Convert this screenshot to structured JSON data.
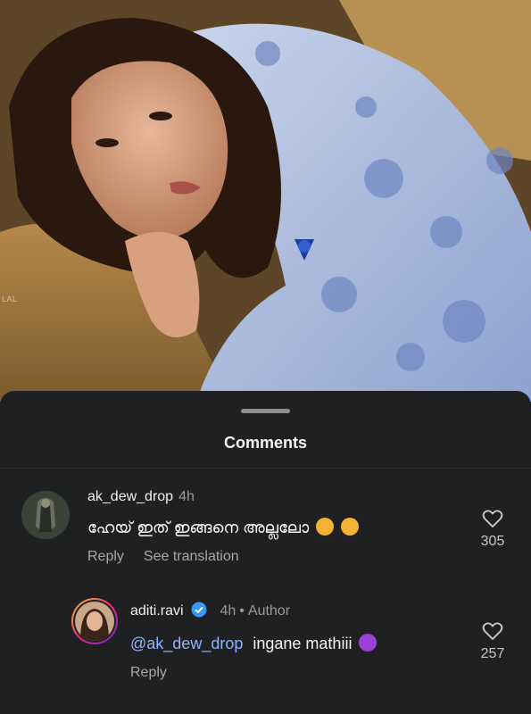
{
  "photo": {
    "watermark": "LAL"
  },
  "sheet": {
    "title": "Comments"
  },
  "comments": [
    {
      "username": "ak_dew_drop",
      "time": "4h",
      "text": "ഹേയ് ഇത് ഇങ്ങനെ അല്ലലോ",
      "emoji": "thinking-face",
      "reply_label": "Reply",
      "translate_label": "See translation",
      "likes": "305"
    },
    {
      "username": "aditi.ravi",
      "verified": true,
      "time": "4h",
      "author_label": "Author",
      "mention": "@ak_dew_drop",
      "text": "ingane mathiii",
      "emoji": "smiling-devil",
      "reply_label": "Reply",
      "likes": "257"
    }
  ],
  "colors": {
    "mention": "#8fb4ff",
    "verified": "#3897f0",
    "sheet_bg": "#1f2022"
  }
}
